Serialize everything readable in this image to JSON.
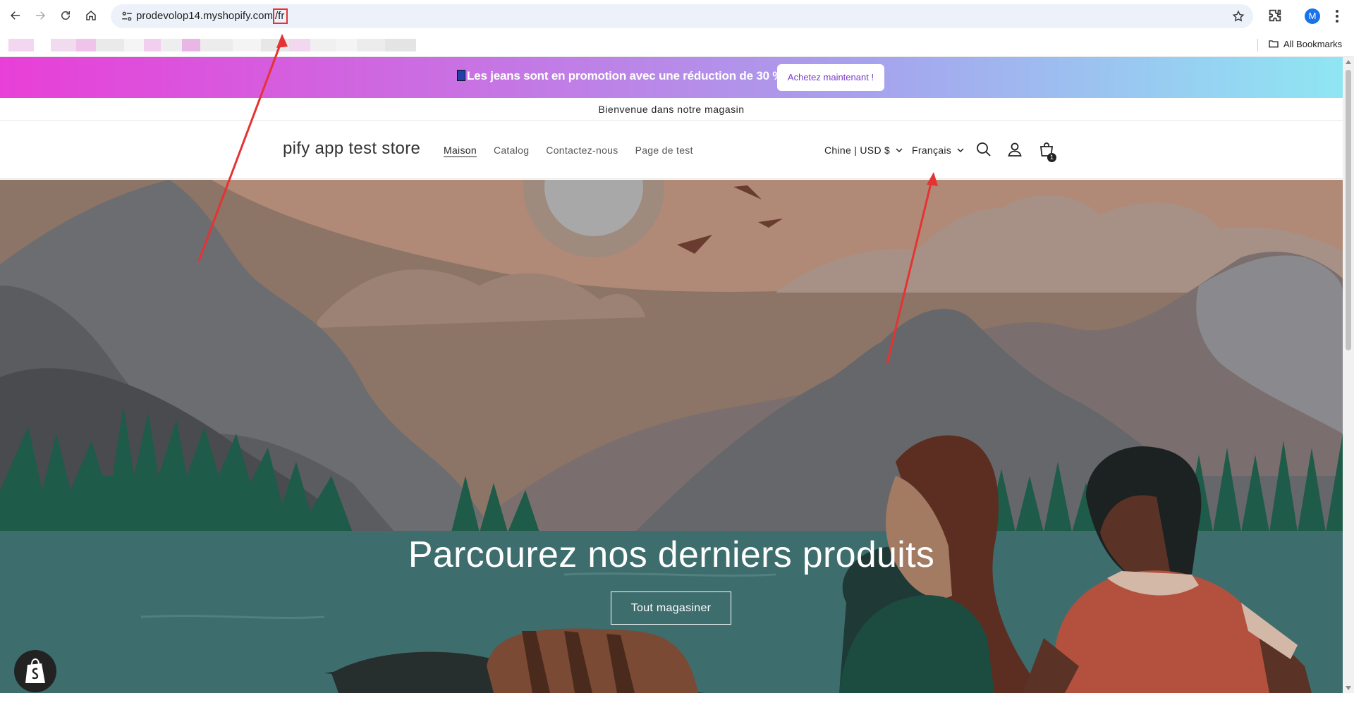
{
  "browser": {
    "url_base": "prodevolop14.myshopify.com",
    "url_path": "/fr",
    "profile_initial": "M",
    "all_bookmarks_label": "All Bookmarks"
  },
  "announcement": {
    "promo_text": "Les jeans sont en promotion avec une réduction de 30 % !",
    "promo_button": "Achetez maintenant !",
    "welcome_text": "Bienvenue dans notre magasin"
  },
  "header": {
    "store_name": "pify app test store",
    "nav": [
      {
        "label": "Maison",
        "active": true
      },
      {
        "label": "Catalog"
      },
      {
        "label": "Contactez-nous"
      },
      {
        "label": "Page de test"
      }
    ],
    "country_selector": "Chine | USD $",
    "language_selector": "Français",
    "cart_count": "1"
  },
  "hero": {
    "title": "Parcourez nos derniers produits",
    "button": "Tout magasiner"
  },
  "colors": {
    "annotation": "#e53333",
    "promo_start": "#e83fd8",
    "promo_end": "#8fe6f3",
    "water": "#3e6d6e"
  }
}
